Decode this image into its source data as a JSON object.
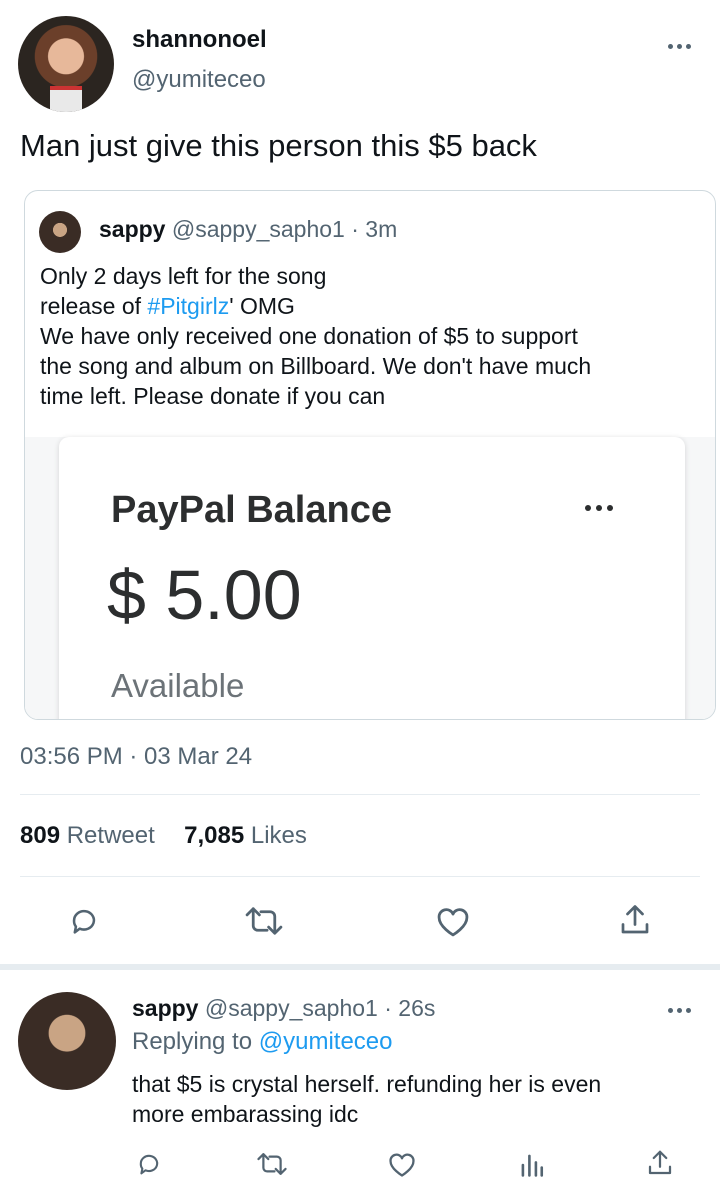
{
  "tweet": {
    "display_name": "shannonoel",
    "handle": "@yumiteceo",
    "text": "Man just give this person this $5 back",
    "timestamp": "03:56 PM · 03 Mar 24",
    "stats": {
      "retweets_count": "809",
      "retweets_label": "Retweet",
      "likes_count": "7,085",
      "likes_label": "Likes"
    }
  },
  "quoted": {
    "display_name": "sappy",
    "handle": "@sappy_sapho1",
    "time": "· 3m",
    "line1": "Only 2 days left for the song",
    "line2_pre": "release of ",
    "line2_tag": "#Pitgirlz",
    "line2_post": "' OMG",
    "line3": "We have only received one donation of $5 to support",
    "line4": "the song and album on Billboard. We don't have much",
    "line5": "time left. Please donate if you can",
    "paypal": {
      "title": "PayPal Balance",
      "amount": "$ 5.00",
      "available": "Available"
    }
  },
  "reply": {
    "display_name": "sappy",
    "handle": "@sappy_sapho1",
    "time": "· 26s",
    "replying_label": "Replying to",
    "replying_handle": "@yumiteceo",
    "line1": "that $5 is crystal herself. refunding her is even",
    "line2": "more embarassing idc"
  },
  "icons": {
    "more": "more-horizontal-icon",
    "reply": "comment-icon",
    "retweet": "retweet-icon",
    "like": "heart-icon",
    "share": "share-icon",
    "analytics": "analytics-icon"
  },
  "colors": {
    "text": "#0f1419",
    "muted": "#536471",
    "link": "#1d9bf0",
    "border": "#cfd9de"
  }
}
